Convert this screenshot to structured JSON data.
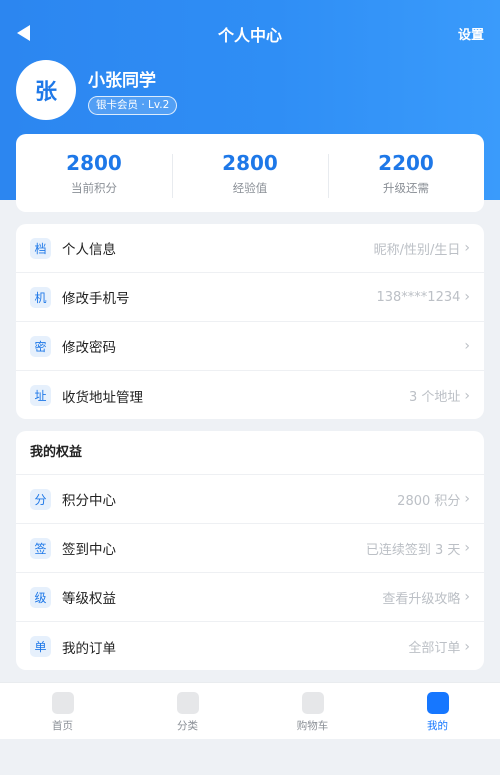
{
  "topbar": {
    "title": "个人中心",
    "settings_label": "设置"
  },
  "profile": {
    "avatar_text": "张",
    "name": "小张同学",
    "badge": "银卡会员 · Lv.2"
  },
  "stats": [
    {
      "value": "2800",
      "label": "当前积分"
    },
    {
      "value": "2800",
      "label": "经验值"
    },
    {
      "value": "2200",
      "label": "升级还需"
    }
  ],
  "account_items": [
    {
      "icon": "档",
      "label": "个人信息",
      "value": "昵称/性别/生日"
    },
    {
      "icon": "机",
      "label": "修改手机号",
      "value": "138****1234"
    },
    {
      "icon": "密",
      "label": "修改密码",
      "value": ""
    },
    {
      "icon": "址",
      "label": "收货地址管理",
      "value": "3 个地址"
    }
  ],
  "benefits": {
    "title": "我的权益",
    "items": [
      {
        "icon": "分",
        "label": "积分中心",
        "value": "2800 积分"
      },
      {
        "icon": "签",
        "label": "签到中心",
        "value": "已连续签到 3 天"
      },
      {
        "icon": "级",
        "label": "等级权益",
        "value": "查看升级攻略"
      },
      {
        "icon": "单",
        "label": "我的订单",
        "value": "全部订单"
      }
    ]
  },
  "chevron": "›",
  "bottom_nav": [
    {
      "label": "首页",
      "active": false
    },
    {
      "label": "分类",
      "active": false
    },
    {
      "label": "购物车",
      "active": false
    },
    {
      "label": "我的",
      "active": true
    }
  ],
  "colors": {
    "primary": "#1e78e8",
    "nav_active": "#1677ff"
  }
}
